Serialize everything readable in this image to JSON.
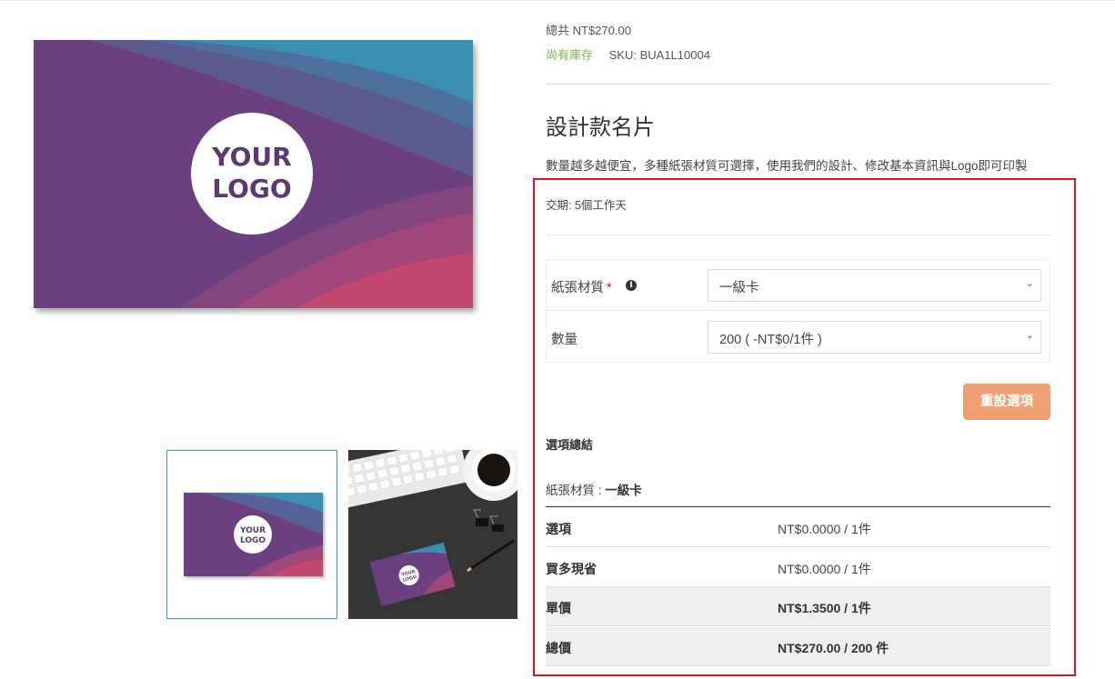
{
  "product": {
    "price_total": "總共 NT$270.00",
    "stock_status": "尚有庫存",
    "sku": "SKU: BUA1L10004",
    "title": "設計款名片",
    "description": "數量越多越便宜，多種紙張材質可選擇，使用我們的設計、修改基本資訊與Logo即可印製",
    "lead_time": "交期: 5個工作天",
    "image_text_line1": "YOUR",
    "image_text_line2": "LOGO"
  },
  "options": {
    "paper_label": "紙張材質",
    "required_mark": "*",
    "info_icon": "i",
    "paper_value": "一級卡",
    "quantity_label": "數量",
    "quantity_value": "200 ( -NT$0/1件 )",
    "chevron": "⌄",
    "reset_label": "重設選項"
  },
  "summary": {
    "title": "選項總結",
    "material_label": "紙張材質 : ",
    "material_value": "一級卡",
    "rows": [
      {
        "label": "選項",
        "value": "NT$0.0000 / 1件"
      },
      {
        "label": "買多現省",
        "value": "NT$0.0000 / 1件"
      },
      {
        "label": "單價",
        "value": "NT$1.3500 / 1件"
      },
      {
        "label": "總價",
        "value": "NT$270.00 / 200 件"
      }
    ]
  },
  "colors": {
    "in_stock": "#7ab840",
    "reset_button": "#f0a070",
    "highlight_border": "#e0141e",
    "thumb_selected_border": "#2aa1c9",
    "card_purple": "#6a4080"
  }
}
